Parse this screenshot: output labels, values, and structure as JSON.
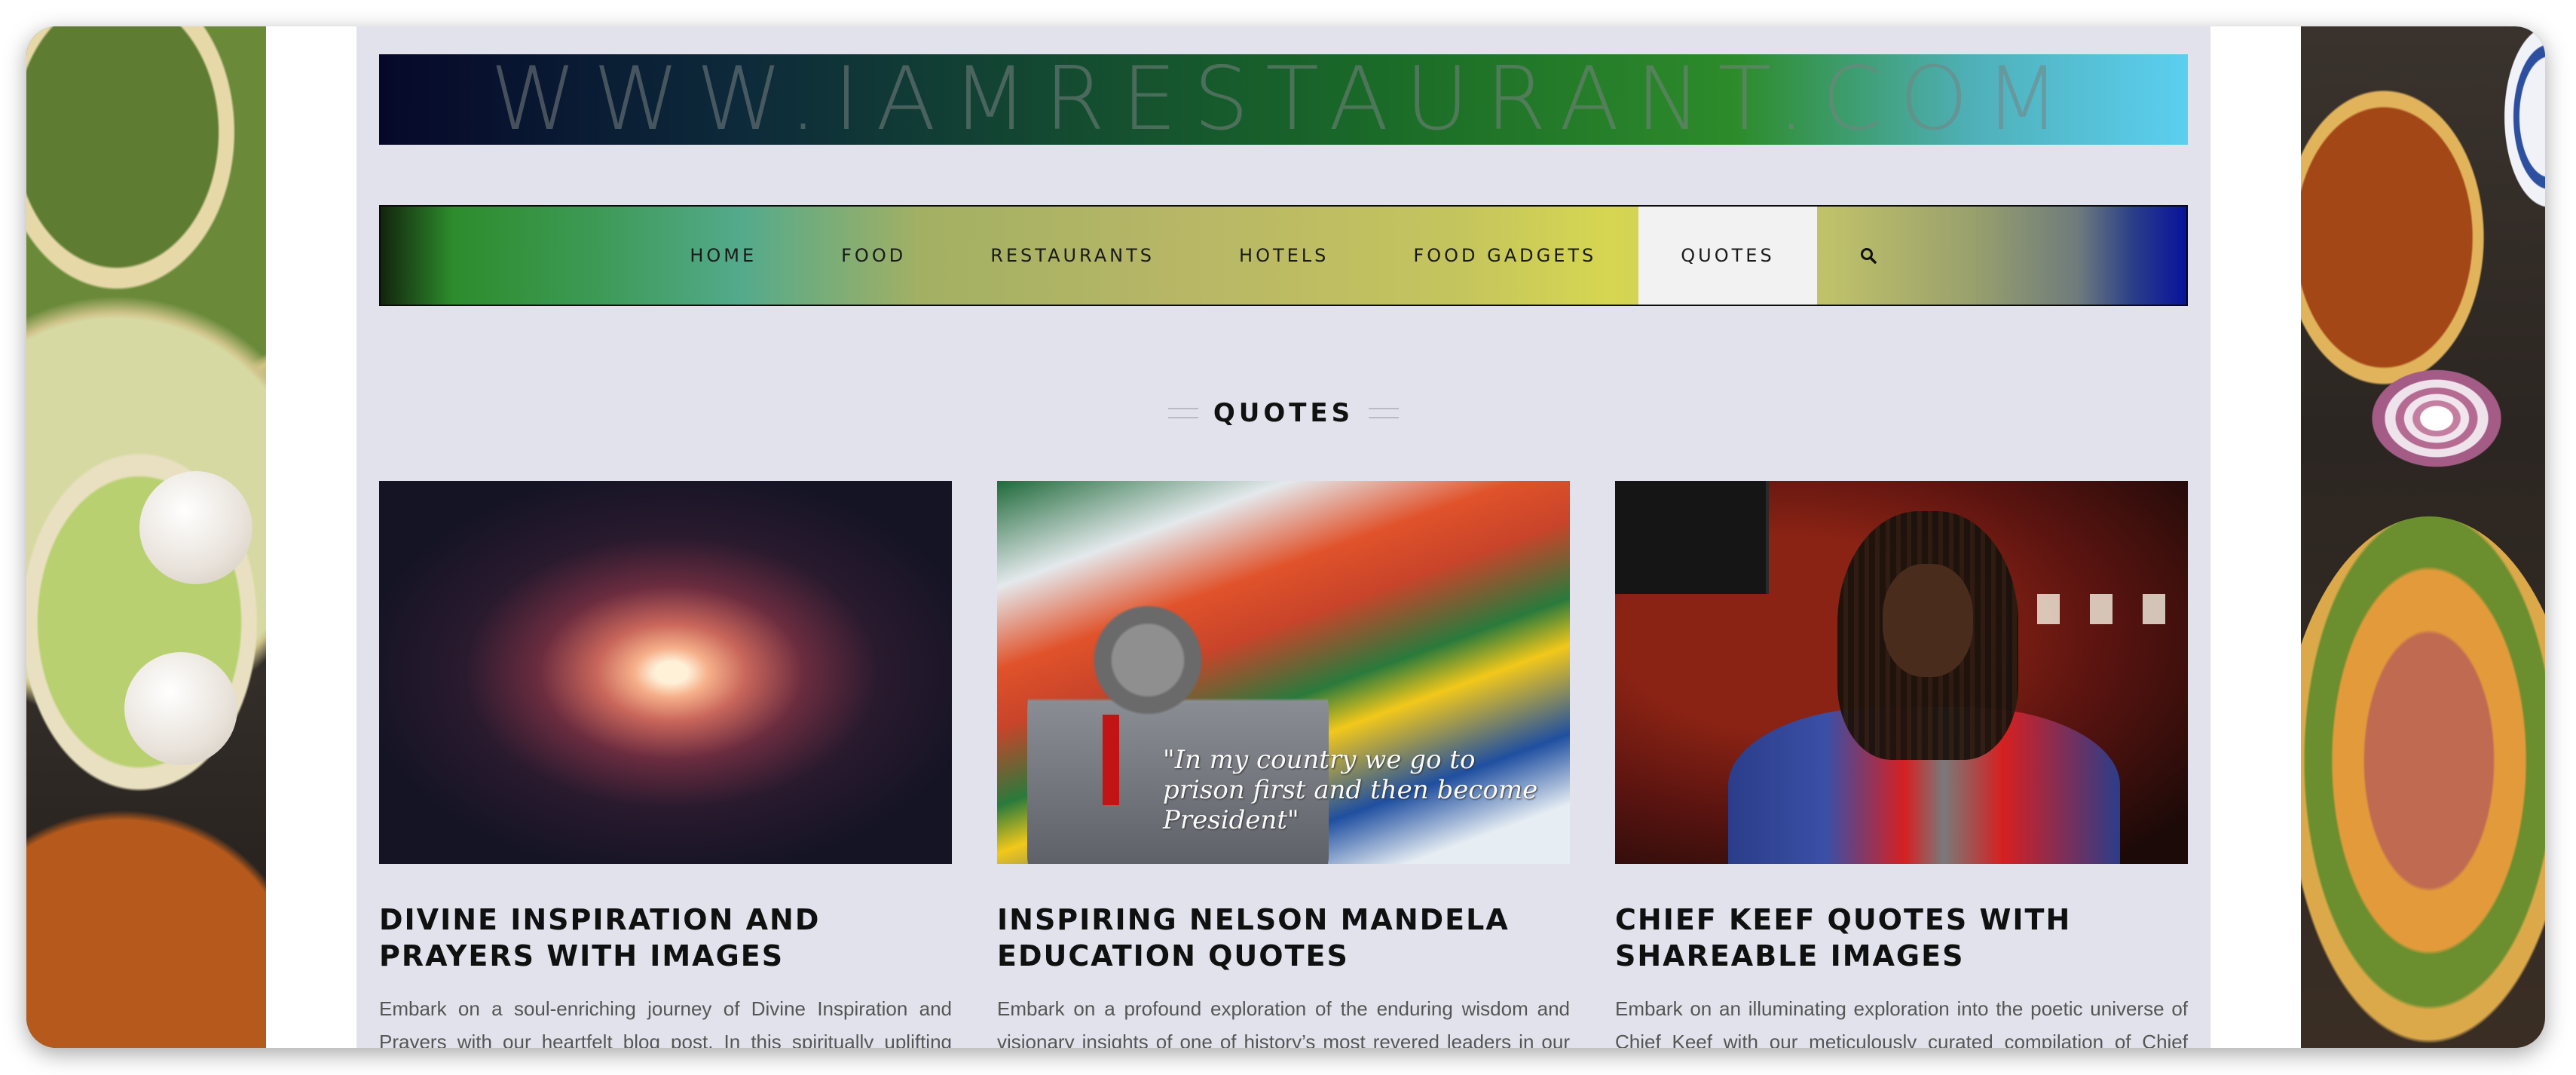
{
  "site": {
    "banner_text": "WWW.IAMRESTAURANT.COM"
  },
  "nav": {
    "items": [
      {
        "label": "HOME"
      },
      {
        "label": "FOOD"
      },
      {
        "label": "RESTAURANTS"
      },
      {
        "label": "HOTELS"
      },
      {
        "label": "FOOD GADGETS"
      },
      {
        "label": "QUOTES",
        "active": true
      }
    ],
    "search_icon": "search-icon"
  },
  "section": {
    "title": "QUOTES"
  },
  "posts": [
    {
      "title": "DIVINE INSPIRATION AND PRAYERS WITH IMAGES",
      "excerpt": "Embark on a soul-enriching journey of Divine Inspiration and Prayers with our heartfelt blog post. In this spiritually uplifting exploration, we curate a collection of profound prayers and divine"
    },
    {
      "title": "INSPIRING NELSON MANDELA EDUCATION QUOTES",
      "excerpt": "Embark on a profound exploration of the enduring wisdom and visionary insights of one of history’s most revered leaders in our latest blog post titled Nelson Mandela Education Quotes. Journey",
      "image_caption": "\"In my country we go to prison first and then become President\""
    },
    {
      "title": "CHIEF KEEF QUOTES WITH SHAREABLE IMAGES",
      "excerpt": "Embark on an illuminating exploration into the poetic universe of Chief Keef with our meticulously curated compilation of Chief Keef quotes. This blog post delves deep into the lyrical reservoir of the"
    }
  ],
  "colors": {
    "content_bg": "#e1e2eb",
    "nav_active_bg": "#f2f2f2",
    "heading": "#101010",
    "excerpt": "#555555"
  }
}
